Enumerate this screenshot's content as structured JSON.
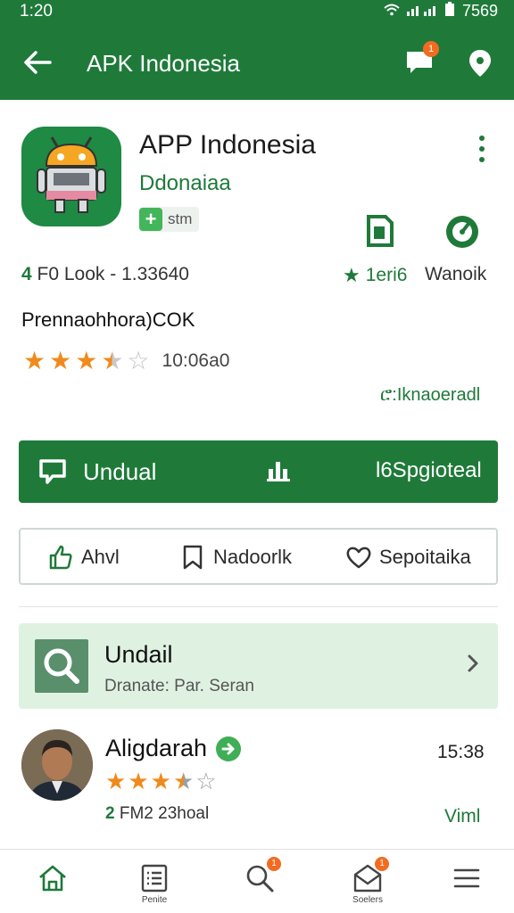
{
  "status_bar": {
    "time": "1:20",
    "right_text": "7569"
  },
  "app_bar": {
    "title": "APK Indonesia",
    "chat_badge": "1"
  },
  "app": {
    "name": "APP Indonesia",
    "developer": "Ddonaiaa",
    "chip_label": "stm",
    "stat_left_num": "4",
    "stat_left_rest": "F0 Look - 1.33640",
    "stat_rating": "1eri6",
    "stat_word": "Wanoik",
    "package": "Prennaohhora)COK",
    "rating_stars": 3.5,
    "rating_count": "10:06a0",
    "more_link": "ሮ:Iknaoeradl"
  },
  "install": {
    "primary_label": "Undual",
    "secondary_label": "l6Spgioteal"
  },
  "actions": [
    {
      "label": "Ahvl",
      "icon": "thumb-up-icon"
    },
    {
      "label": "Nadoorlk",
      "icon": "bookmark-icon"
    },
    {
      "label": "Sepoitaika",
      "icon": "heart-icon"
    }
  ],
  "suggest": {
    "title": "Undail",
    "subtitle": "Dranate: Par. Seran"
  },
  "review": {
    "name": "Aligdarah",
    "time": "15:38",
    "stars": 3.5,
    "meta_num": "2",
    "meta_rest": "FM2 23hoal",
    "link": "Viml"
  },
  "bottom_nav": [
    {
      "caption": "",
      "icon": "home-icon"
    },
    {
      "caption": "Penite",
      "icon": "list-icon"
    },
    {
      "caption": "",
      "icon": "search-icon",
      "badge": "1"
    },
    {
      "caption": "Soelers",
      "icon": "mail-icon",
      "badge": "1"
    },
    {
      "caption": "",
      "icon": "menu-icon"
    }
  ],
  "colors": {
    "primary": "#1f7a3a",
    "accent_star": "#f08a1c",
    "badge": "#f26b21",
    "suggest_bg": "#dff2e2"
  }
}
